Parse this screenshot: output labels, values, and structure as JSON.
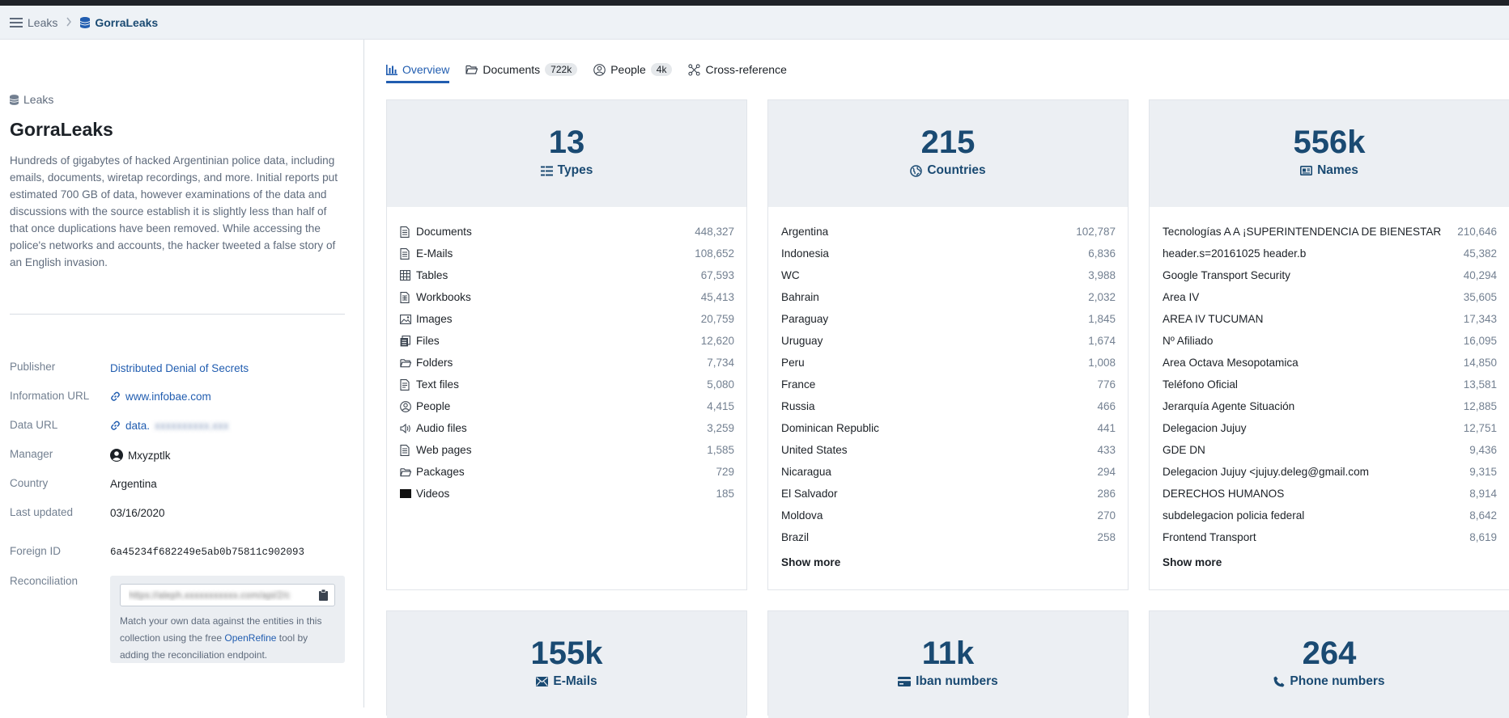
{
  "breadcrumb": {
    "root": "Leaks",
    "current": "GorraLeaks"
  },
  "sidebar": {
    "kicker": "Leaks",
    "title": "GorraLeaks",
    "description": "Hundreds of gigabytes of hacked Argentinian police data, including emails, documents, wiretap recordings, and more. Initial reports put estimated 700 GB of data, however examinations of the data and discussions with the source establish it is slightly less than half of that once duplications have been removed. While accessing the police's networks and accounts, the hacker tweeted a false story of an English invasion.",
    "meta": {
      "publisher_label": "Publisher",
      "publisher_value": "Distributed Denial of Secrets",
      "info_url_label": "Information URL",
      "info_url_value": "www.infobae.com",
      "data_url_label": "Data URL",
      "data_url_value": "data.",
      "manager_label": "Manager",
      "manager_value": "Mxyzptlk",
      "country_label": "Country",
      "country_value": "Argentina",
      "updated_label": "Last updated",
      "updated_value": "03/16/2020",
      "foreign_id_label": "Foreign ID",
      "foreign_id_value": "6a45234f682249e5ab0b75811c902093",
      "recon_label": "Reconciliation",
      "recon_help_1": "Match your own data against the entities in this collection using the free ",
      "recon_help_link": "OpenRefine",
      "recon_help_2": " tool by adding the reconciliation endpoint."
    }
  },
  "tabs": [
    {
      "label": "Overview"
    },
    {
      "label": "Documents",
      "count": "722k"
    },
    {
      "label": "People",
      "count": "4k"
    },
    {
      "label": "Cross-reference"
    }
  ],
  "cards": {
    "types": {
      "number": "13",
      "label": "Types",
      "rows": [
        {
          "icon": "document-icon",
          "name": "Documents",
          "count": "448,327"
        },
        {
          "icon": "email-doc-icon",
          "name": "E-Mails",
          "count": "108,652"
        },
        {
          "icon": "table-icon",
          "name": "Tables",
          "count": "67,593"
        },
        {
          "icon": "workbook-icon",
          "name": "Workbooks",
          "count": "45,413"
        },
        {
          "icon": "image-icon",
          "name": "Images",
          "count": "20,759"
        },
        {
          "icon": "files-icon",
          "name": "Files",
          "count": "12,620"
        },
        {
          "icon": "folder-icon",
          "name": "Folders",
          "count": "7,734"
        },
        {
          "icon": "text-file-icon",
          "name": "Text files",
          "count": "5,080"
        },
        {
          "icon": "person-icon",
          "name": "People",
          "count": "4,415"
        },
        {
          "icon": "audio-icon",
          "name": "Audio files",
          "count": "3,259"
        },
        {
          "icon": "web-page-icon",
          "name": "Web pages",
          "count": "1,585"
        },
        {
          "icon": "package-icon",
          "name": "Packages",
          "count": "729"
        },
        {
          "icon": "video-icon",
          "name": "Videos",
          "count": "185"
        }
      ]
    },
    "countries": {
      "number": "215",
      "label": "Countries",
      "rows": [
        {
          "name": "Argentina",
          "count": "102,787"
        },
        {
          "name": "Indonesia",
          "count": "6,836"
        },
        {
          "name": "WC",
          "count": "3,988"
        },
        {
          "name": "Bahrain",
          "count": "2,032"
        },
        {
          "name": "Paraguay",
          "count": "1,845"
        },
        {
          "name": "Uruguay",
          "count": "1,674"
        },
        {
          "name": "Peru",
          "count": "1,008"
        },
        {
          "name": "France",
          "count": "776"
        },
        {
          "name": "Russia",
          "count": "466"
        },
        {
          "name": "Dominican Republic",
          "count": "441"
        },
        {
          "name": "United States",
          "count": "433"
        },
        {
          "name": "Nicaragua",
          "count": "294"
        },
        {
          "name": "El Salvador",
          "count": "286"
        },
        {
          "name": "Moldova",
          "count": "270"
        },
        {
          "name": "Brazil",
          "count": "258"
        }
      ],
      "show_more": "Show more"
    },
    "names": {
      "number": "556k",
      "label": "Names",
      "rows": [
        {
          "name": "Tecnologías A A ¡SUPERINTENDENCIA DE BIENESTAR",
          "count": "210,646"
        },
        {
          "name": "header.s=20161025 header.b",
          "count": "45,382"
        },
        {
          "name": "Google Transport Security",
          "count": "40,294"
        },
        {
          "name": "Area IV",
          "count": "35,605"
        },
        {
          "name": "AREA IV TUCUMAN",
          "count": "17,343"
        },
        {
          "name": "Nº Afiliado",
          "count": "16,095"
        },
        {
          "name": "Area Octava Mesopotamica",
          "count": "14,850"
        },
        {
          "name": "Teléfono Oficial",
          "count": "13,581"
        },
        {
          "name": "Jerarquía Agente Situación",
          "count": "12,885"
        },
        {
          "name": "Delegacion Jujuy",
          "count": "12,751"
        },
        {
          "name": "GDE DN",
          "count": "9,436"
        },
        {
          "name": "Delegacion Jujuy <jujuy.deleg@gmail.com",
          "count": "9,315"
        },
        {
          "name": "DERECHOS HUMANOS",
          "count": "8,914"
        },
        {
          "name": "subdelegacion policia federal",
          "count": "8,642"
        },
        {
          "name": "Frontend Transport",
          "count": "8,619"
        }
      ],
      "show_more": "Show more"
    },
    "emails": {
      "number": "155k",
      "label": "E-Mails"
    },
    "ibans": {
      "number": "11k",
      "label": "Iban numbers"
    },
    "phones": {
      "number": "264",
      "label": "Phone numbers"
    }
  },
  "colors": {
    "accent": "#215db0",
    "stat_blue": "#1a4a72",
    "card_head_bg": "#eceff3",
    "topbar_bg": "#eef2f6"
  }
}
